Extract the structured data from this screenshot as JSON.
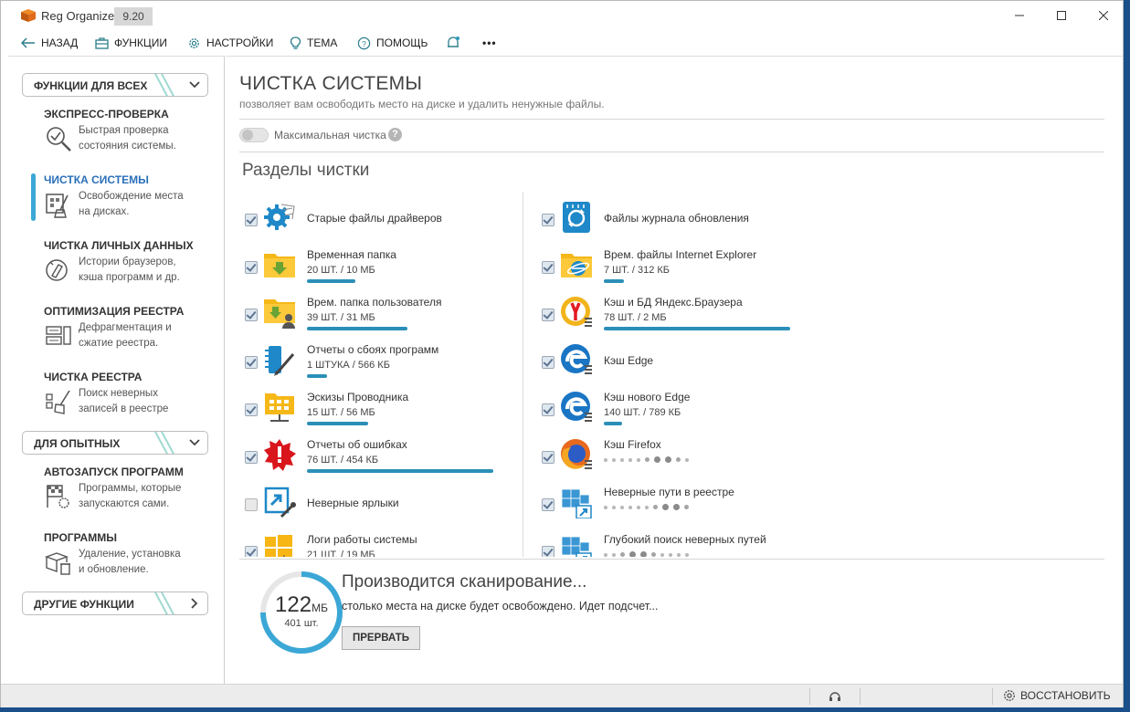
{
  "app": {
    "title": "Reg Organizer",
    "version": "9.20"
  },
  "toolbar": {
    "back": "НАЗАД",
    "functions": "ФУНКЦИИ",
    "settings": "НАСТРОЙКИ",
    "theme": "ТЕМА",
    "help": "ПОМОЩЬ",
    "more": "•••"
  },
  "sidebar": {
    "cat_all": "ФУНКЦИИ ДЛЯ ВСЕХ",
    "cat_advanced": "ДЛЯ ОПЫТНЫХ",
    "cat_other": "ДРУГИЕ ФУНКЦИИ",
    "items": [
      {
        "title": "ЭКСПРЕСС-ПРОВЕРКА",
        "desc1": "Быстрая проверка",
        "desc2": "состояния системы."
      },
      {
        "title": "ЧИСТКА СИСТЕМЫ",
        "desc1": "Освобождение места",
        "desc2": "на дисках."
      },
      {
        "title": "ЧИСТКА ЛИЧНЫХ ДАННЫХ",
        "desc1": "Истории браузеров,",
        "desc2": "кэша программ и др."
      },
      {
        "title": "ОПТИМИЗАЦИЯ РЕЕСТРА",
        "desc1": "Дефрагментация и",
        "desc2": "сжатие реестра."
      },
      {
        "title": "ЧИСТКА РЕЕСТРА",
        "desc1": "Поиск неверных",
        "desc2": "записей в реестре"
      },
      {
        "title": "АВТОЗАПУСК ПРОГРАММ",
        "desc1": "Программы, которые",
        "desc2": "запускаются сами."
      },
      {
        "title": "ПРОГРАММЫ",
        "desc1": "Удаление, установка",
        "desc2": "и обновление."
      }
    ]
  },
  "main": {
    "title": "ЧИСТКА СИСТЕМЫ",
    "subtitle": "позволяет вам освободить место на диске и удалить ненужные файлы.",
    "toggle_label": "Максимальная чистка",
    "help_mark": "?",
    "sections_title": "Разделы чистки",
    "left_items": [
      {
        "name": "Старые файлы драйверов",
        "stats": "",
        "checked": true,
        "progress": 0
      },
      {
        "name": "Временная папка",
        "stats": "20 ШТ. / 10 МБ",
        "checked": true,
        "progress": 0.26
      },
      {
        "name": "Врем. папка пользователя",
        "stats": "39 ШТ. / 31 МБ",
        "checked": true,
        "progress": 0.54
      },
      {
        "name": "Отчеты о сбоях программ",
        "stats": "1 ШТУКА / 566 КБ",
        "checked": true,
        "progress": 0.11
      },
      {
        "name": "Эскизы Проводника",
        "stats": "15 ШТ. / 56 МБ",
        "checked": true,
        "progress": 0.33
      },
      {
        "name": "Отчеты об ошибках",
        "stats": "76 ШТ. / 454 КБ",
        "checked": true,
        "progress": 1.0
      },
      {
        "name": "Неверные ярлыки",
        "stats": "",
        "checked": false,
        "progress": 0
      },
      {
        "name": "Логи работы системы",
        "stats": "21 ШТ. / 19 МБ",
        "checked": true,
        "progress": 0
      }
    ],
    "right_items": [
      {
        "name": "Файлы журнала обновления",
        "stats": "",
        "checked": true
      },
      {
        "name": "Врем. файлы Internet Explorer",
        "stats": "7 ШТ. / 312 КБ",
        "checked": true,
        "progress": 0.11
      },
      {
        "name": "Кэш и БД Яндекс.Браузера",
        "stats": "78 ШТ. / 2 МБ",
        "checked": true,
        "progress": 1.0
      },
      {
        "name": "Кэш Edge",
        "stats": "",
        "checked": true
      },
      {
        "name": "Кэш нового Edge",
        "stats": "140 ШТ. / 789 КБ",
        "checked": true,
        "progress": 0.1
      },
      {
        "name": "Кэш Firefox",
        "stats": "",
        "checked": true
      },
      {
        "name": "Неверные пути в реестре",
        "stats": "",
        "checked": true
      },
      {
        "name": "Глубокий поиск неверных путей",
        "stats": "",
        "checked": true
      }
    ]
  },
  "scan": {
    "size_value": "122",
    "size_unit": "МБ",
    "count": "401 шт.",
    "title": "Производится сканирование...",
    "subtitle": "столько места на диске будет освобождено. Идет подсчет...",
    "stop_button": "ПРЕРВАТЬ"
  },
  "statusbar": {
    "restore": "ВОССТАНОВИТЬ"
  },
  "colors": {
    "accent": "#2b8fb8",
    "ring": "#3ba7d6",
    "active_bar": "#3ba7d6",
    "active_title": "#2a6fb8"
  }
}
